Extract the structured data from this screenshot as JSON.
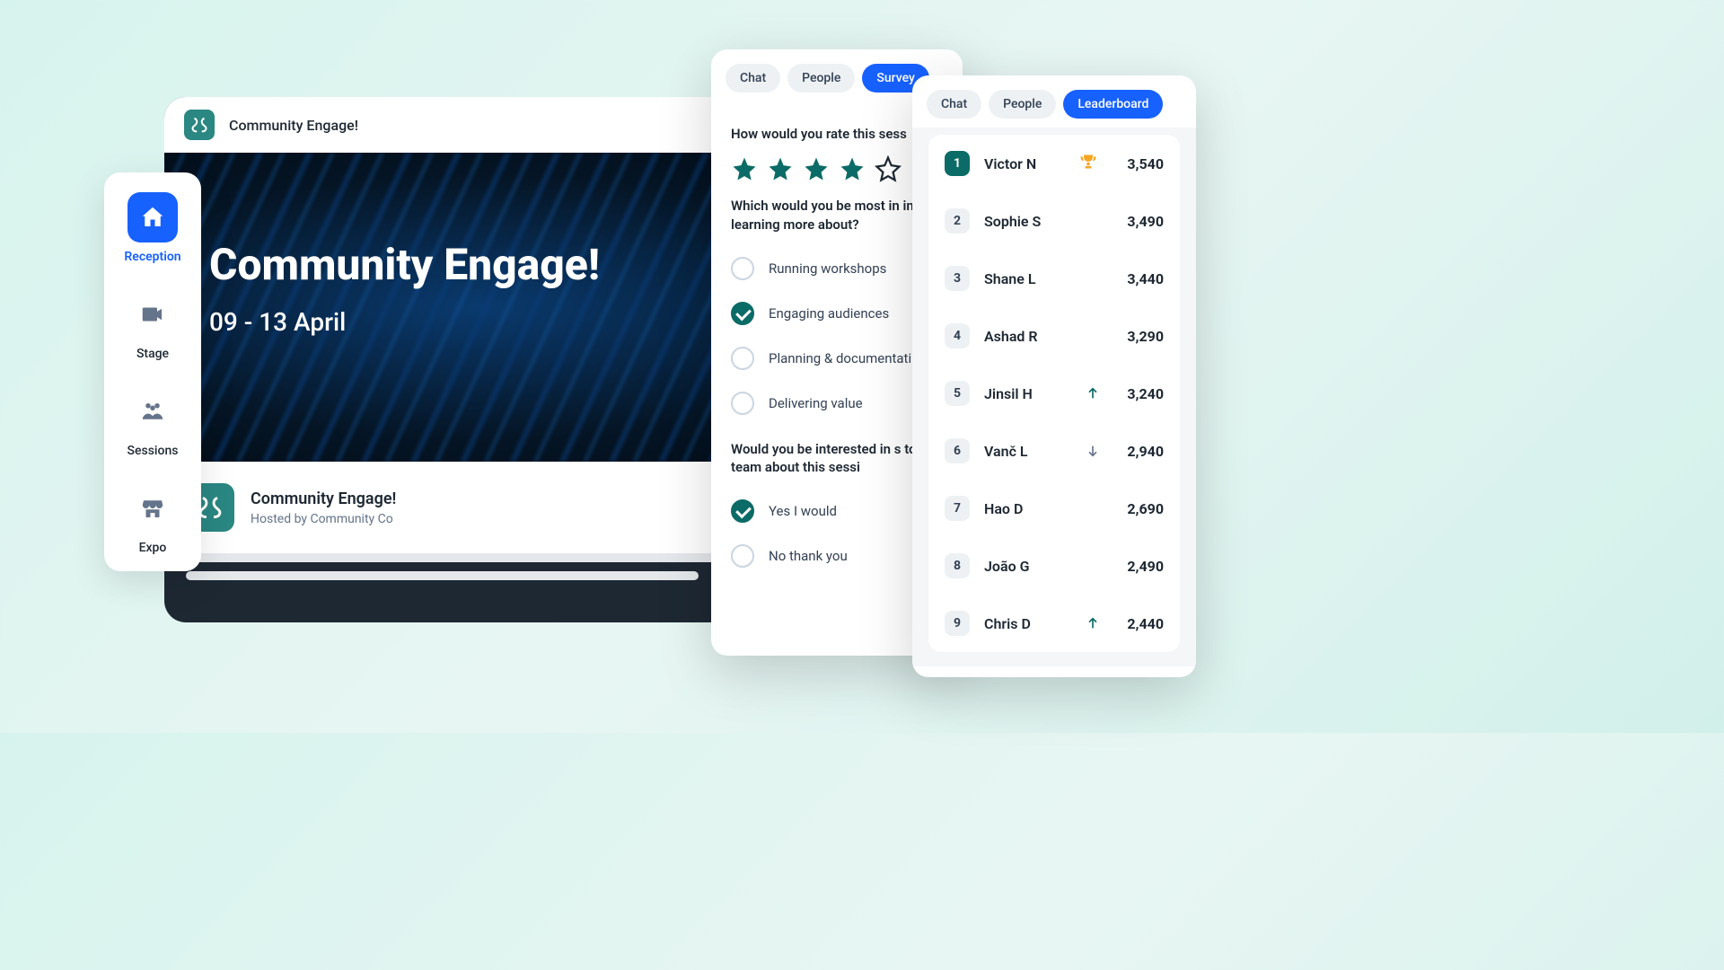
{
  "header": {
    "title": "Community Engage!"
  },
  "hero": {
    "title": "Community Engage!",
    "dates": "09 - 13 April"
  },
  "event": {
    "name": "Community Engage!",
    "host": "Hosted by Community Co"
  },
  "sidebar": {
    "items": [
      {
        "label": "Reception",
        "icon": "house-icon",
        "active": true
      },
      {
        "label": "Stage",
        "icon": "camera-icon",
        "active": false
      },
      {
        "label": "Sessions",
        "icon": "people-icon",
        "active": false
      },
      {
        "label": "Expo",
        "icon": "booth-icon",
        "active": false
      }
    ]
  },
  "survey": {
    "tabs": [
      {
        "label": "Chat",
        "active": false
      },
      {
        "label": "People",
        "active": false
      },
      {
        "label": "Survey",
        "active": true
      }
    ],
    "q1": "How would you rate this sess",
    "rating": 4,
    "q2": "Which would you be most in in learning more about?",
    "options2": [
      {
        "label": "Running workshops",
        "checked": false
      },
      {
        "label": "Engaging audiences",
        "checked": true
      },
      {
        "label": "Planning & documentati",
        "checked": false
      },
      {
        "label": "Delivering value",
        "checked": false
      }
    ],
    "q3": "Would you be interested in s to our team about this sessi",
    "options3": [
      {
        "label": "Yes I would",
        "checked": true
      },
      {
        "label": "No thank you",
        "checked": false
      }
    ]
  },
  "leaderboard": {
    "tabs": [
      {
        "label": "Chat",
        "active": false
      },
      {
        "label": "People",
        "active": false
      },
      {
        "label": "Leaderboard",
        "active": true
      }
    ],
    "rows": [
      {
        "rank": "1",
        "name": "Victor N",
        "score": "3,540",
        "trophy": true
      },
      {
        "rank": "2",
        "name": "Sophie S",
        "score": "3,490"
      },
      {
        "rank": "3",
        "name": "Shane L",
        "score": "3,440"
      },
      {
        "rank": "4",
        "name": "Ashad R",
        "score": "3,290"
      },
      {
        "rank": "5",
        "name": "Jinsil H",
        "score": "3,240",
        "trend": "up"
      },
      {
        "rank": "6",
        "name": "Vanč L",
        "score": "2,940",
        "trend": "down"
      },
      {
        "rank": "7",
        "name": "Hao D",
        "score": "2,690"
      },
      {
        "rank": "8",
        "name": "João G",
        "score": "2,490"
      },
      {
        "rank": "9",
        "name": "Chris D",
        "score": "2,440",
        "trend": "up"
      }
    ]
  }
}
